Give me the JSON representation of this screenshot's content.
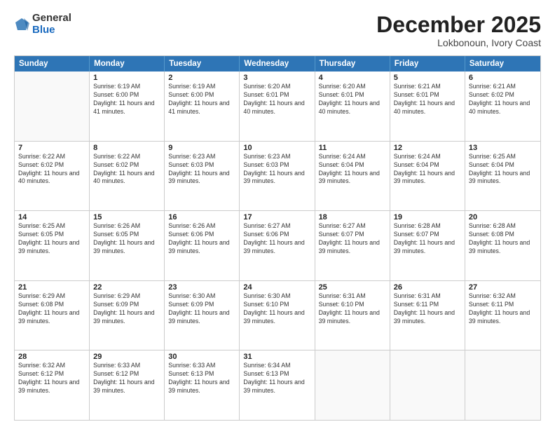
{
  "header": {
    "logo": {
      "general": "General",
      "blue": "Blue"
    },
    "title": "December 2025",
    "location": "Lokbonoun, Ivory Coast"
  },
  "calendar": {
    "days_of_week": [
      "Sunday",
      "Monday",
      "Tuesday",
      "Wednesday",
      "Thursday",
      "Friday",
      "Saturday"
    ],
    "weeks": [
      [
        {
          "day": "",
          "empty": true
        },
        {
          "day": "1",
          "sunrise": "Sunrise: 6:19 AM",
          "sunset": "Sunset: 6:00 PM",
          "daylight": "Daylight: 11 hours and 41 minutes."
        },
        {
          "day": "2",
          "sunrise": "Sunrise: 6:19 AM",
          "sunset": "Sunset: 6:00 PM",
          "daylight": "Daylight: 11 hours and 41 minutes."
        },
        {
          "day": "3",
          "sunrise": "Sunrise: 6:20 AM",
          "sunset": "Sunset: 6:01 PM",
          "daylight": "Daylight: 11 hours and 40 minutes."
        },
        {
          "day": "4",
          "sunrise": "Sunrise: 6:20 AM",
          "sunset": "Sunset: 6:01 PM",
          "daylight": "Daylight: 11 hours and 40 minutes."
        },
        {
          "day": "5",
          "sunrise": "Sunrise: 6:21 AM",
          "sunset": "Sunset: 6:01 PM",
          "daylight": "Daylight: 11 hours and 40 minutes."
        },
        {
          "day": "6",
          "sunrise": "Sunrise: 6:21 AM",
          "sunset": "Sunset: 6:02 PM",
          "daylight": "Daylight: 11 hours and 40 minutes."
        }
      ],
      [
        {
          "day": "7",
          "sunrise": "Sunrise: 6:22 AM",
          "sunset": "Sunset: 6:02 PM",
          "daylight": "Daylight: 11 hours and 40 minutes."
        },
        {
          "day": "8",
          "sunrise": "Sunrise: 6:22 AM",
          "sunset": "Sunset: 6:02 PM",
          "daylight": "Daylight: 11 hours and 40 minutes."
        },
        {
          "day": "9",
          "sunrise": "Sunrise: 6:23 AM",
          "sunset": "Sunset: 6:03 PM",
          "daylight": "Daylight: 11 hours and 39 minutes."
        },
        {
          "day": "10",
          "sunrise": "Sunrise: 6:23 AM",
          "sunset": "Sunset: 6:03 PM",
          "daylight": "Daylight: 11 hours and 39 minutes."
        },
        {
          "day": "11",
          "sunrise": "Sunrise: 6:24 AM",
          "sunset": "Sunset: 6:04 PM",
          "daylight": "Daylight: 11 hours and 39 minutes."
        },
        {
          "day": "12",
          "sunrise": "Sunrise: 6:24 AM",
          "sunset": "Sunset: 6:04 PM",
          "daylight": "Daylight: 11 hours and 39 minutes."
        },
        {
          "day": "13",
          "sunrise": "Sunrise: 6:25 AM",
          "sunset": "Sunset: 6:04 PM",
          "daylight": "Daylight: 11 hours and 39 minutes."
        }
      ],
      [
        {
          "day": "14",
          "sunrise": "Sunrise: 6:25 AM",
          "sunset": "Sunset: 6:05 PM",
          "daylight": "Daylight: 11 hours and 39 minutes."
        },
        {
          "day": "15",
          "sunrise": "Sunrise: 6:26 AM",
          "sunset": "Sunset: 6:05 PM",
          "daylight": "Daylight: 11 hours and 39 minutes."
        },
        {
          "day": "16",
          "sunrise": "Sunrise: 6:26 AM",
          "sunset": "Sunset: 6:06 PM",
          "daylight": "Daylight: 11 hours and 39 minutes."
        },
        {
          "day": "17",
          "sunrise": "Sunrise: 6:27 AM",
          "sunset": "Sunset: 6:06 PM",
          "daylight": "Daylight: 11 hours and 39 minutes."
        },
        {
          "day": "18",
          "sunrise": "Sunrise: 6:27 AM",
          "sunset": "Sunset: 6:07 PM",
          "daylight": "Daylight: 11 hours and 39 minutes."
        },
        {
          "day": "19",
          "sunrise": "Sunrise: 6:28 AM",
          "sunset": "Sunset: 6:07 PM",
          "daylight": "Daylight: 11 hours and 39 minutes."
        },
        {
          "day": "20",
          "sunrise": "Sunrise: 6:28 AM",
          "sunset": "Sunset: 6:08 PM",
          "daylight": "Daylight: 11 hours and 39 minutes."
        }
      ],
      [
        {
          "day": "21",
          "sunrise": "Sunrise: 6:29 AM",
          "sunset": "Sunset: 6:08 PM",
          "daylight": "Daylight: 11 hours and 39 minutes."
        },
        {
          "day": "22",
          "sunrise": "Sunrise: 6:29 AM",
          "sunset": "Sunset: 6:09 PM",
          "daylight": "Daylight: 11 hours and 39 minutes."
        },
        {
          "day": "23",
          "sunrise": "Sunrise: 6:30 AM",
          "sunset": "Sunset: 6:09 PM",
          "daylight": "Daylight: 11 hours and 39 minutes."
        },
        {
          "day": "24",
          "sunrise": "Sunrise: 6:30 AM",
          "sunset": "Sunset: 6:10 PM",
          "daylight": "Daylight: 11 hours and 39 minutes."
        },
        {
          "day": "25",
          "sunrise": "Sunrise: 6:31 AM",
          "sunset": "Sunset: 6:10 PM",
          "daylight": "Daylight: 11 hours and 39 minutes."
        },
        {
          "day": "26",
          "sunrise": "Sunrise: 6:31 AM",
          "sunset": "Sunset: 6:11 PM",
          "daylight": "Daylight: 11 hours and 39 minutes."
        },
        {
          "day": "27",
          "sunrise": "Sunrise: 6:32 AM",
          "sunset": "Sunset: 6:11 PM",
          "daylight": "Daylight: 11 hours and 39 minutes."
        }
      ],
      [
        {
          "day": "28",
          "sunrise": "Sunrise: 6:32 AM",
          "sunset": "Sunset: 6:12 PM",
          "daylight": "Daylight: 11 hours and 39 minutes."
        },
        {
          "day": "29",
          "sunrise": "Sunrise: 6:33 AM",
          "sunset": "Sunset: 6:12 PM",
          "daylight": "Daylight: 11 hours and 39 minutes."
        },
        {
          "day": "30",
          "sunrise": "Sunrise: 6:33 AM",
          "sunset": "Sunset: 6:13 PM",
          "daylight": "Daylight: 11 hours and 39 minutes."
        },
        {
          "day": "31",
          "sunrise": "Sunrise: 6:34 AM",
          "sunset": "Sunset: 6:13 PM",
          "daylight": "Daylight: 11 hours and 39 minutes."
        },
        {
          "day": "",
          "empty": true
        },
        {
          "day": "",
          "empty": true
        },
        {
          "day": "",
          "empty": true
        }
      ]
    ]
  }
}
